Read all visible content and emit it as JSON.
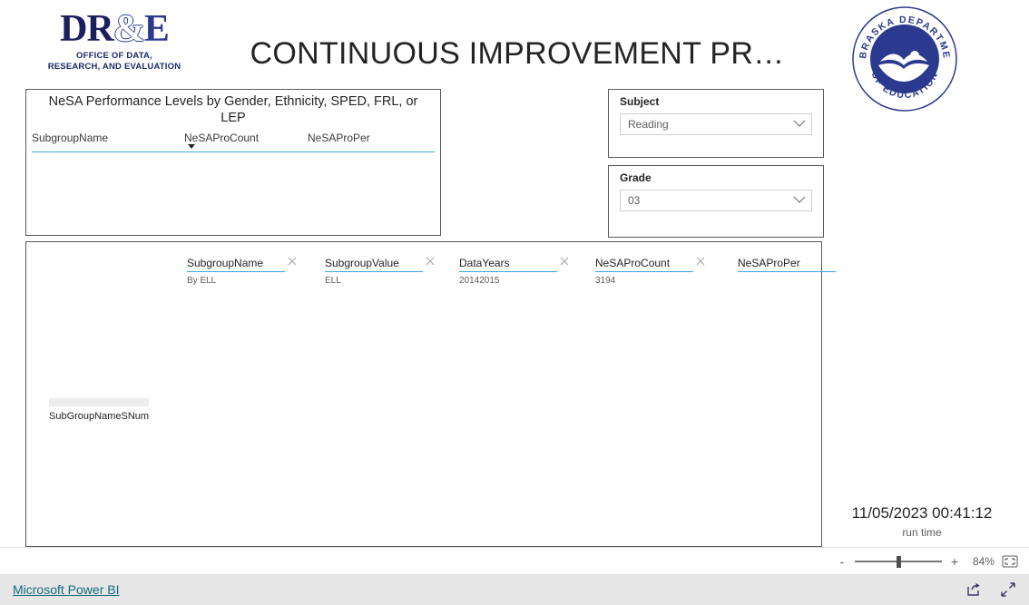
{
  "header": {
    "logo": {
      "wordmark_dr": "DR",
      "wordmark_amp": "&",
      "wordmark_e": "E",
      "subtitle_line1": "OFFICE OF DATA,",
      "subtitle_line2": "RESEARCH, AND EVALUATION"
    },
    "title": "CONTINUOUS IMPROVEMENT PR…",
    "seal": {
      "top_text": "NEBRASKA DEPARTMENT",
      "bottom_text": "OF EDUCATION",
      "color": "#2b3a8f"
    }
  },
  "table_visual": {
    "title": "NeSA Performance Levels by Gender, Ethnicity, SPED, FRL, or LEP",
    "columns": [
      "SubgroupName",
      "NeSAProCount",
      "NeSAProPer"
    ],
    "sorted_column": "NeSAProCount",
    "sort_direction": "descending",
    "rows": [],
    "underline_color": "#3da7e0"
  },
  "slicers": [
    {
      "label": "Subject",
      "value": "Reading",
      "icon": "chevron-down-icon"
    },
    {
      "label": "Grade",
      "value": "03",
      "icon": "chevron-down-icon"
    }
  ],
  "filters_visual": {
    "chips": [
      {
        "name": "SubgroupName",
        "value": "By ELL",
        "removable": true
      },
      {
        "name": "SubgroupValue",
        "value": "ELL",
        "removable": true
      },
      {
        "name": "DataYears",
        "value": "20142015",
        "removable": true
      },
      {
        "name": "NeSAProCount",
        "value": "3194",
        "removable": true
      },
      {
        "name": "NeSAProPer",
        "value": "",
        "removable": false
      }
    ],
    "placeholder_label": "SubGroupNameSNum"
  },
  "runtime": {
    "value": "11/05/2023 00:41:12",
    "caption": "run time"
  },
  "status_bar": {
    "zoom_out_label": "-",
    "zoom_in_label": "+",
    "zoom_percent": "84%",
    "fit_icon": "fit-to-page-icon"
  },
  "footer": {
    "brand_link": "Microsoft Power BI",
    "share_icon": "share-icon",
    "fullscreen_icon": "fullscreen-icon",
    "brand_color": "#0f6b7b"
  }
}
